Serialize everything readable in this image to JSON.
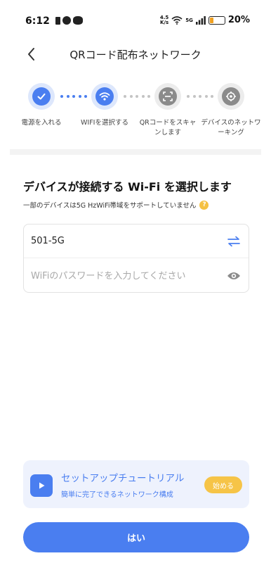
{
  "status_bar": {
    "time": "6:12",
    "speed_value": "4.5",
    "speed_unit": "K/s",
    "network": "5G",
    "battery": "20%"
  },
  "header": {
    "title": "QRコード配布ネットワーク"
  },
  "steps": [
    {
      "label": "電源を入れる",
      "icon": "check-icon",
      "state": "done"
    },
    {
      "label": "WIFIを選択する",
      "icon": "wifi-icon",
      "state": "current"
    },
    {
      "label": "QRコードをスキャンします",
      "icon": "scan-icon",
      "state": "pending"
    },
    {
      "label": "デバイスのネットワーキング",
      "icon": "network-icon",
      "state": "pending"
    }
  ],
  "main": {
    "heading": "デバイスが接続する Wi-Fi を選択します",
    "note": "一部のデバイスは5G HzWiFi帯域をサポートしていません",
    "ssid_value": "501-5G",
    "password_placeholder": "WiFiのパスワードを入力してください"
  },
  "tutorial": {
    "title": "セットアップチュートリアル",
    "subtitle": "簡単に完了できるネットワーク構成",
    "start_label": "始める"
  },
  "confirm_button": {
    "label": "はい"
  },
  "colors": {
    "accent": "#4a7ef0",
    "accent_light": "#dde7fc",
    "tutorial_bg": "#eef2fd",
    "start_button": "#f6c447",
    "inactive": "#8b8b8b"
  }
}
